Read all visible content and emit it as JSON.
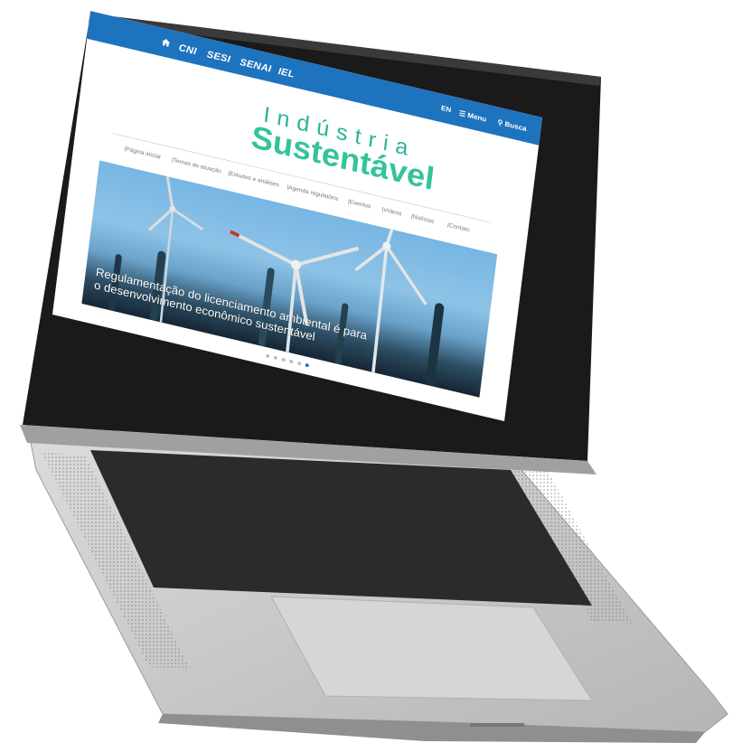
{
  "topbar": {
    "brands": [
      "CNI",
      "SESI",
      "SENAI",
      "IEL"
    ],
    "lang_label": "EN",
    "menu_label": "Menu",
    "search_label": "Busca"
  },
  "logo": {
    "line1": "Indústria",
    "line2": "Sustentável"
  },
  "nav": {
    "items": [
      "Página inicial",
      "Temas de atuação",
      "Estudos e análises",
      "Agenda regulatória",
      "Eventos",
      "Vídeos",
      "Notícias",
      "Contato"
    ]
  },
  "hero": {
    "caption_line1": "Regulamentação do licenciamento ambiental é para",
    "caption_line2": "o desenvolvimento econômico sustentável",
    "slide_count": 6,
    "active_slide": 6
  },
  "colors": {
    "topbar": "#1d73be",
    "logo_green": "#34c39a",
    "active_dot": "#1d73be"
  }
}
